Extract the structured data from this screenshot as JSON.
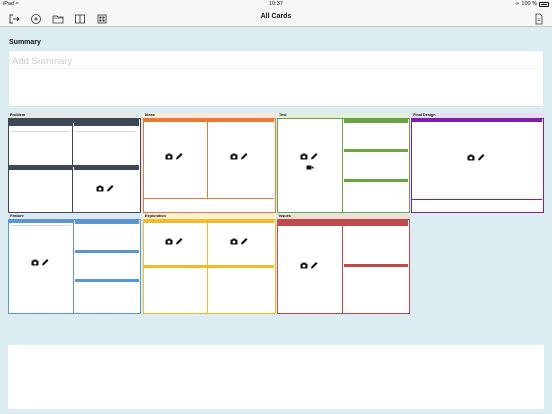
{
  "status_bar": {
    "device": "iPad",
    "wifi": "wifi-icon",
    "time": "10:37",
    "battery": "100 %"
  },
  "toolbar": {
    "title": "All Cards",
    "icons": [
      "exit-icon",
      "add-circle-icon",
      "folder-icon",
      "book-icon",
      "grid-icon",
      "document-icon"
    ]
  },
  "summary": {
    "label": "Summary",
    "placeholder": "Add Summary"
  },
  "cards": [
    {
      "name": "Problem",
      "color": "#3e4756"
    },
    {
      "name": "Ideas",
      "color": "#ec7a35"
    },
    {
      "name": "Test",
      "color": "#6ca342"
    },
    {
      "name": "Final Design",
      "color": "#7d1fa8"
    },
    {
      "name": "Feature",
      "color": "#5b96d0"
    },
    {
      "name": "Exploration",
      "color": "#f5ba2b"
    },
    {
      "name": "Issues",
      "color": "#bd4b4c"
    }
  ]
}
